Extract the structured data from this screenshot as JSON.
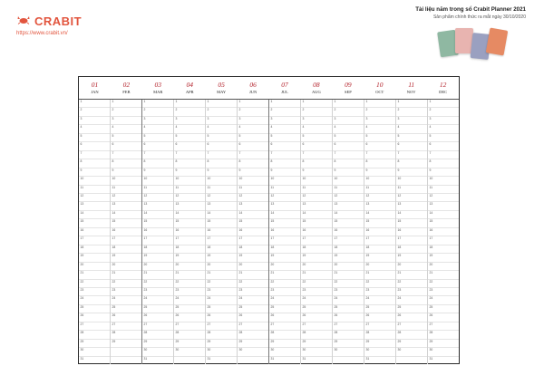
{
  "brand": {
    "name": "CRABIT",
    "website": "https://www.crabit.vn/",
    "color": "#e2553e"
  },
  "promo": {
    "title": "Tài liệu năm trong sổ Crabit Planner 2021",
    "subtitle": "Sản phẩm chính thức ra mắt ngày 30/10/2020"
  },
  "books": [
    {
      "color": "#8fb8a2"
    },
    {
      "color": "#e8b4b0"
    },
    {
      "color": "#9aa0c0"
    },
    {
      "color": "#e68a63"
    }
  ],
  "accent_color": "#b3222b",
  "calendar": {
    "months": [
      {
        "num": "01",
        "name": "JAN",
        "days": 31
      },
      {
        "num": "02",
        "name": "FEB",
        "days": 29
      },
      {
        "num": "03",
        "name": "MAR",
        "days": 31
      },
      {
        "num": "04",
        "name": "APR",
        "days": 30
      },
      {
        "num": "05",
        "name": "MAY",
        "days": 31
      },
      {
        "num": "06",
        "name": "JUN",
        "days": 30
      },
      {
        "num": "07",
        "name": "JUL",
        "days": 31
      },
      {
        "num": "08",
        "name": "AUG",
        "days": 31
      },
      {
        "num": "09",
        "name": "SEP",
        "days": 30
      },
      {
        "num": "10",
        "name": "OCT",
        "days": 31
      },
      {
        "num": "11",
        "name": "NOV",
        "days": 30
      },
      {
        "num": "12",
        "name": "DEC",
        "days": 31
      }
    ]
  }
}
